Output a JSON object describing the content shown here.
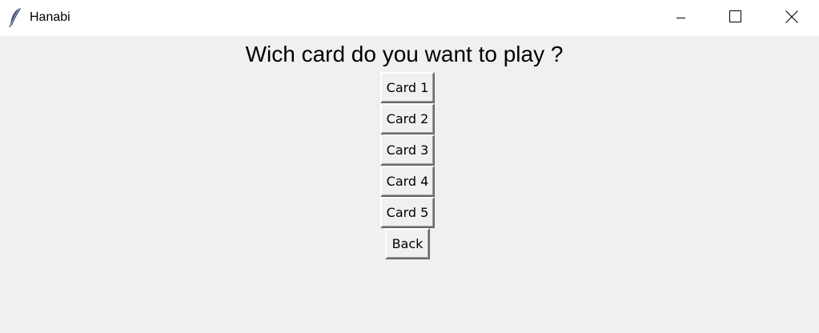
{
  "window": {
    "title": "Hanabi",
    "icons": {
      "app": "feather-icon",
      "minimize": "minimize-icon",
      "maximize": "maximize-icon",
      "close": "close-icon"
    }
  },
  "main": {
    "prompt": "Wich card do you want to play ?",
    "cards": [
      {
        "label": "Card 1"
      },
      {
        "label": "Card 2"
      },
      {
        "label": "Card 3"
      },
      {
        "label": "Card 4"
      },
      {
        "label": "Card 5"
      }
    ],
    "back_label": "Back"
  },
  "colors": {
    "titlebar": "#ffffff",
    "background": "#f0f0f0",
    "button_face": "#f0f0f0",
    "button_shadow": "#696969",
    "button_highlight": "#ffffff"
  }
}
